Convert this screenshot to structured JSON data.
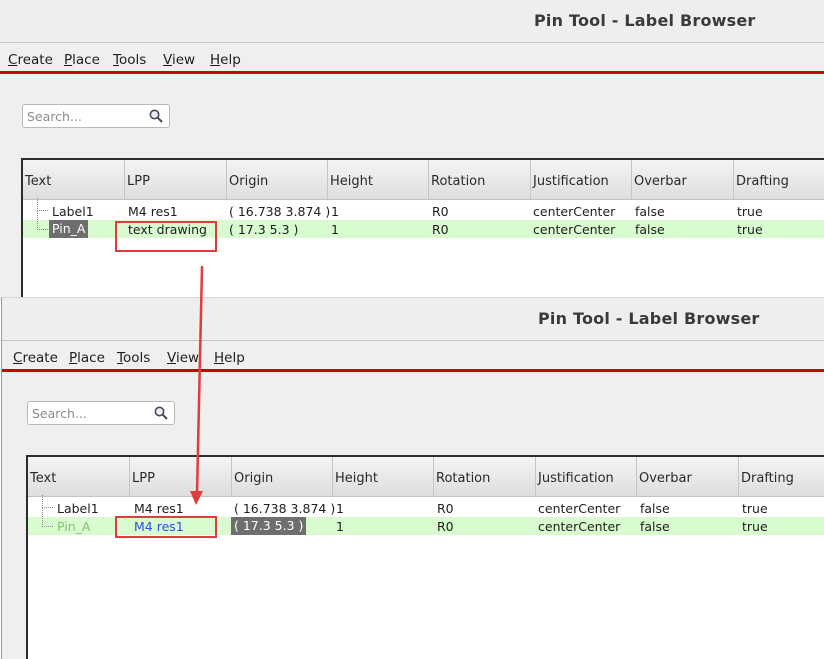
{
  "before": {
    "title": "Pin Tool - Label Browser",
    "menu": [
      {
        "key": "C",
        "rest": "reate"
      },
      {
        "key": "P",
        "rest": "lace"
      },
      {
        "key": "T",
        "rest": "ools"
      },
      {
        "key": "V",
        "rest": "iew"
      },
      {
        "key": "H",
        "rest": "elp"
      }
    ],
    "search_placeholder": "Search...",
    "columns": [
      "Text",
      "LPP",
      "Origin",
      "Height",
      "Rotation",
      "Justification",
      "Overbar",
      "Drafting"
    ],
    "rows": [
      {
        "text": "Label1",
        "lpp": "M4 res1",
        "origin": "( 16.738 3.874 )",
        "height": "1",
        "rotation": "R0",
        "justification": "centerCenter",
        "overbar": "false",
        "drafting": "true"
      },
      {
        "text": "Pin_A",
        "lpp": "text drawing",
        "origin": "( 17.3 5.3 )",
        "height": "1",
        "rotation": "R0",
        "justification": "centerCenter",
        "overbar": "false",
        "drafting": "true"
      }
    ]
  },
  "after": {
    "title": "Pin Tool - Label Browser",
    "menu": [
      {
        "key": "C",
        "rest": "reate"
      },
      {
        "key": "P",
        "rest": "lace"
      },
      {
        "key": "T",
        "rest": "ools"
      },
      {
        "key": "V",
        "rest": "iew"
      },
      {
        "key": "H",
        "rest": "elp"
      }
    ],
    "search_placeholder": "Search...",
    "columns": [
      "Text",
      "LPP",
      "Origin",
      "Height",
      "Rotation",
      "Justification",
      "Overbar",
      "Drafting"
    ],
    "rows": [
      {
        "text": "Label1",
        "lpp": "M4 res1",
        "origin": "( 16.738 3.874 )",
        "height": "1",
        "rotation": "R0",
        "justification": "centerCenter",
        "overbar": "false",
        "drafting": "true"
      },
      {
        "text": "Pin_A",
        "lpp": "M4 res1",
        "origin": "( 17.3 5.3 )",
        "height": "1",
        "rotation": "R0",
        "justification": "centerCenter",
        "overbar": "false",
        "drafting": "true"
      }
    ]
  },
  "colors": {
    "accent_line": "#cc0000",
    "selected_row": "#d8fbd0",
    "callout": "#e23b3b",
    "edited_value": "#2f4fe0"
  },
  "icons": {
    "search": "magnifier-icon",
    "annotation": "arrow-icon"
  }
}
